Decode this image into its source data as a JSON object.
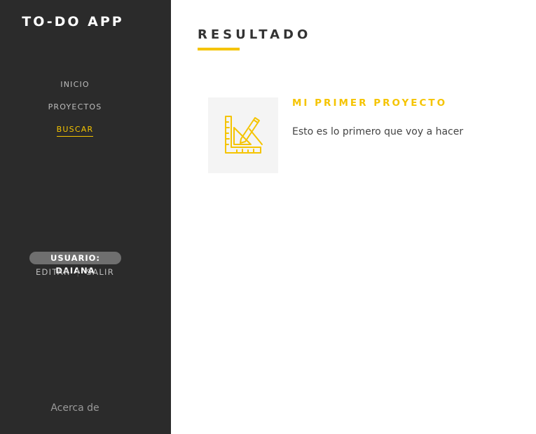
{
  "sidebar": {
    "brand": "TO-DO APP",
    "nav": [
      {
        "label": "INICIO",
        "active": false
      },
      {
        "label": "PROYECTOS",
        "active": false
      },
      {
        "label": "BUSCAR",
        "active": true
      }
    ],
    "user_badge": "USUARIO: DAIANA",
    "edit_label": "EDITAR",
    "separator": "|",
    "logout_label": "SALIR",
    "about_label": "Acerca de"
  },
  "main": {
    "title": "RESULTADO",
    "results": [
      {
        "title": "MI PRIMER PROYECTO",
        "description": "Esto es lo primero que voy a hacer",
        "icon": "ruler-pencil-icon"
      }
    ]
  },
  "colors": {
    "accent": "#f5c400",
    "sidebar_bg": "#2b2b2b",
    "badge_bg": "#6f6f6f"
  }
}
